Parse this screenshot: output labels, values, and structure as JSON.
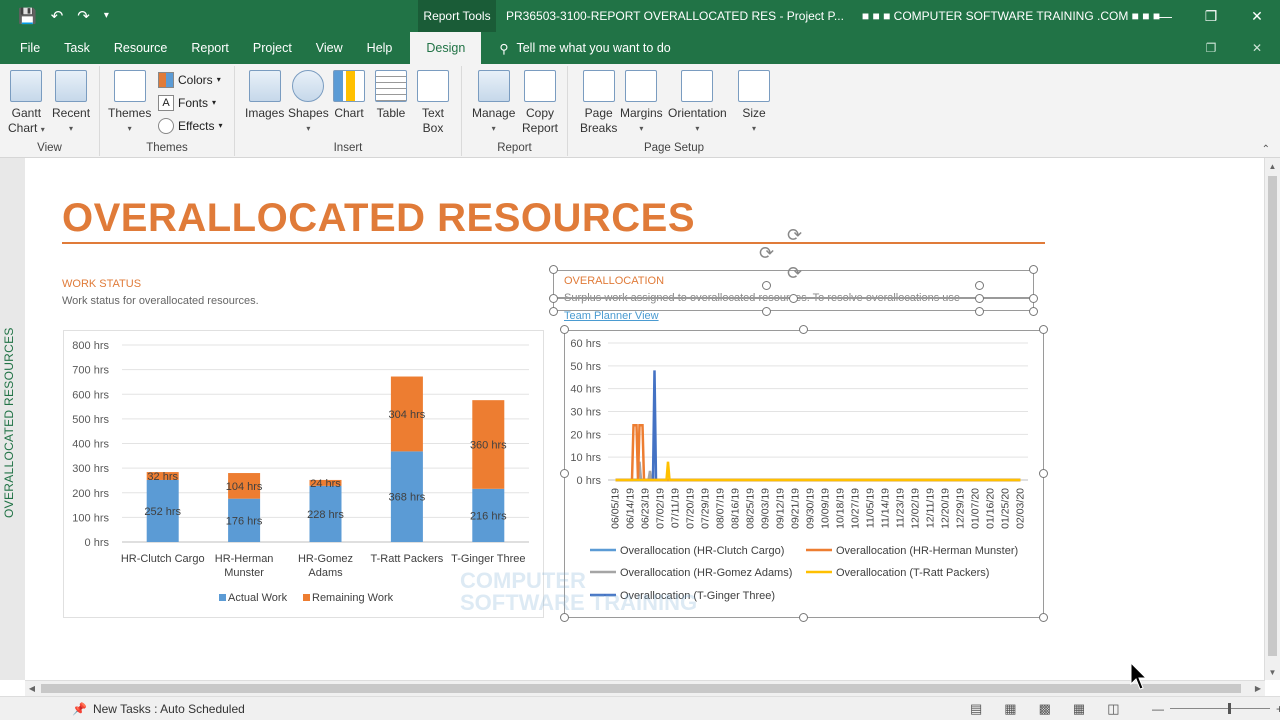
{
  "titlebar": {
    "context_tab": "Report Tools",
    "window_title": "PR36503-3100-REPORT OVERALLOCATED RES  -  Project P...",
    "brand": "■ ■ ■ COMPUTER SOFTWARE TRAINING .COM ■ ■ ■"
  },
  "tabs": [
    "File",
    "Task",
    "Resource",
    "Report",
    "Project",
    "View",
    "Help"
  ],
  "active_tab": "Design",
  "tell_me": "Tell me what you want to do",
  "ribbon": {
    "view": {
      "label": "View",
      "gantt": "Gantt\nChart",
      "gantt_1": "Gantt",
      "gantt_2": "Chart",
      "recent": "Recent"
    },
    "themes": {
      "label": "Themes",
      "themes": "Themes",
      "colors": "Colors",
      "fonts": "Fonts",
      "effects": "Effects"
    },
    "insert": {
      "label": "Insert",
      "images": "Images",
      "shapes": "Shapes",
      "chart": "Chart",
      "table": "Table",
      "textbox_1": "Text",
      "textbox_2": "Box"
    },
    "report": {
      "label": "Report",
      "manage": "Manage",
      "copy_1": "Copy",
      "copy_2": "Report"
    },
    "page_setup": {
      "label": "Page Setup",
      "breaks_1": "Page",
      "breaks_2": "Breaks",
      "margins": "Margins",
      "orientation": "Orientation",
      "size": "Size"
    }
  },
  "report": {
    "side_label": "OVERALLOCATED RESOURCES",
    "title": "OVERALLOCATED RESOURCES",
    "work_status": {
      "heading": "WORK STATUS",
      "subtitle": "Work status for overallocated resources."
    },
    "overallocation": {
      "heading": "OVERALLOCATION",
      "subtitle": "Surplus work assigned to overallocated resources. To resolve overallocations use",
      "link": "Team Planner View"
    },
    "watermark_1": "COMPUTER",
    "watermark_2": "SOFTWARE TRAINING"
  },
  "status": {
    "new_tasks": "New Tasks : Auto Scheduled"
  },
  "colors": {
    "brand_green": "#217346",
    "accent_orange": "#e07b39",
    "actual_blue": "#5b9bd5",
    "remaining_orange": "#ed7d31"
  },
  "chart_data": [
    {
      "type": "bar",
      "stacked": true,
      "categories": [
        "HR-Clutch Cargo",
        "HR-Herman Munster",
        "HR-Gomez Adams",
        "T-Ratt Packers",
        "T-Ginger Three"
      ],
      "category_lines": [
        [
          "HR-Clutch Cargo"
        ],
        [
          "HR-Herman",
          "Munster"
        ],
        [
          "HR-Gomez",
          "Adams"
        ],
        [
          "T-Ratt Packers"
        ],
        [
          "T-Ginger Three"
        ]
      ],
      "series": [
        {
          "name": "Actual Work",
          "color": "#5b9bd5",
          "values": [
            252,
            176,
            228,
            368,
            216
          ]
        },
        {
          "name": "Remaining Work",
          "color": "#ed7d31",
          "values": [
            32,
            104,
            24,
            304,
            360
          ]
        }
      ],
      "data_labels": [
        [
          "252 hrs",
          "176 hrs",
          "228 hrs",
          "368 hrs",
          "216 hrs"
        ],
        [
          "32 hrs",
          "104 hrs",
          "24 hrs",
          "304 hrs",
          "360 hrs"
        ]
      ],
      "ylim": [
        0,
        800
      ],
      "yticks": [
        0,
        100,
        200,
        300,
        400,
        500,
        600,
        700,
        800
      ],
      "ytick_labels": [
        "0 hrs",
        "100 hrs",
        "200 hrs",
        "300 hrs",
        "400 hrs",
        "500 hrs",
        "600 hrs",
        "700 hrs",
        "800 hrs"
      ],
      "grid": true,
      "legend": "bottom"
    },
    {
      "type": "line",
      "x": [
        "06/05/19",
        "06/14/19",
        "06/23/19",
        "07/02/19",
        "07/11/19",
        "07/20/19",
        "07/29/19",
        "08/07/19",
        "08/16/19",
        "08/25/19",
        "09/03/19",
        "09/12/19",
        "09/21/19",
        "09/30/19",
        "10/09/19",
        "10/18/19",
        "10/27/19",
        "11/05/19",
        "11/14/19",
        "11/23/19",
        "12/02/19",
        "12/11/19",
        "12/20/19",
        "12/29/19",
        "01/07/20",
        "01/16/20",
        "01/25/20",
        "02/03/20"
      ],
      "series": [
        {
          "name": "Overallocation (HR-Clutch Cargo)",
          "color": "#5b9bd5",
          "points": [
            [
              0,
              0
            ],
            [
              27,
              0
            ]
          ]
        },
        {
          "name": "Overallocation (HR-Herman Munster)",
          "color": "#ed7d31",
          "points": [
            [
              0,
              0
            ],
            [
              1.1,
              0
            ],
            [
              1.2,
              24
            ],
            [
              1.4,
              24
            ],
            [
              1.5,
              0
            ],
            [
              1.6,
              24
            ],
            [
              1.8,
              24
            ],
            [
              1.9,
              0
            ],
            [
              27,
              0
            ]
          ]
        },
        {
          "name": "Overallocation (HR-Gomez Adams)",
          "color": "#a5a5a5",
          "points": [
            [
              0,
              0
            ],
            [
              1.5,
              0
            ],
            [
              1.6,
              8
            ],
            [
              1.7,
              0
            ],
            [
              2.2,
              0
            ],
            [
              2.3,
              4
            ],
            [
              2.4,
              0
            ],
            [
              27,
              0
            ]
          ]
        },
        {
          "name": "Overallocation (T-Ratt Packers)",
          "color": "#ffc000",
          "points": [
            [
              0,
              0
            ],
            [
              3.4,
              0
            ],
            [
              3.5,
              8
            ],
            [
              3.6,
              0
            ],
            [
              27,
              0
            ]
          ]
        },
        {
          "name": "Overallocation (T-Ginger Three)",
          "color": "#4472c4",
          "points": [
            [
              0,
              0
            ],
            [
              2.5,
              0
            ],
            [
              2.6,
              48
            ],
            [
              2.7,
              0
            ],
            [
              27,
              0
            ]
          ]
        }
      ],
      "ylim": [
        0,
        60
      ],
      "yticks": [
        0,
        10,
        20,
        30,
        40,
        50,
        60
      ],
      "ytick_labels": [
        "0 hrs",
        "10 hrs",
        "20 hrs",
        "30 hrs",
        "40 hrs",
        "50 hrs",
        "60 hrs"
      ],
      "grid": true,
      "legend": "bottom"
    }
  ]
}
